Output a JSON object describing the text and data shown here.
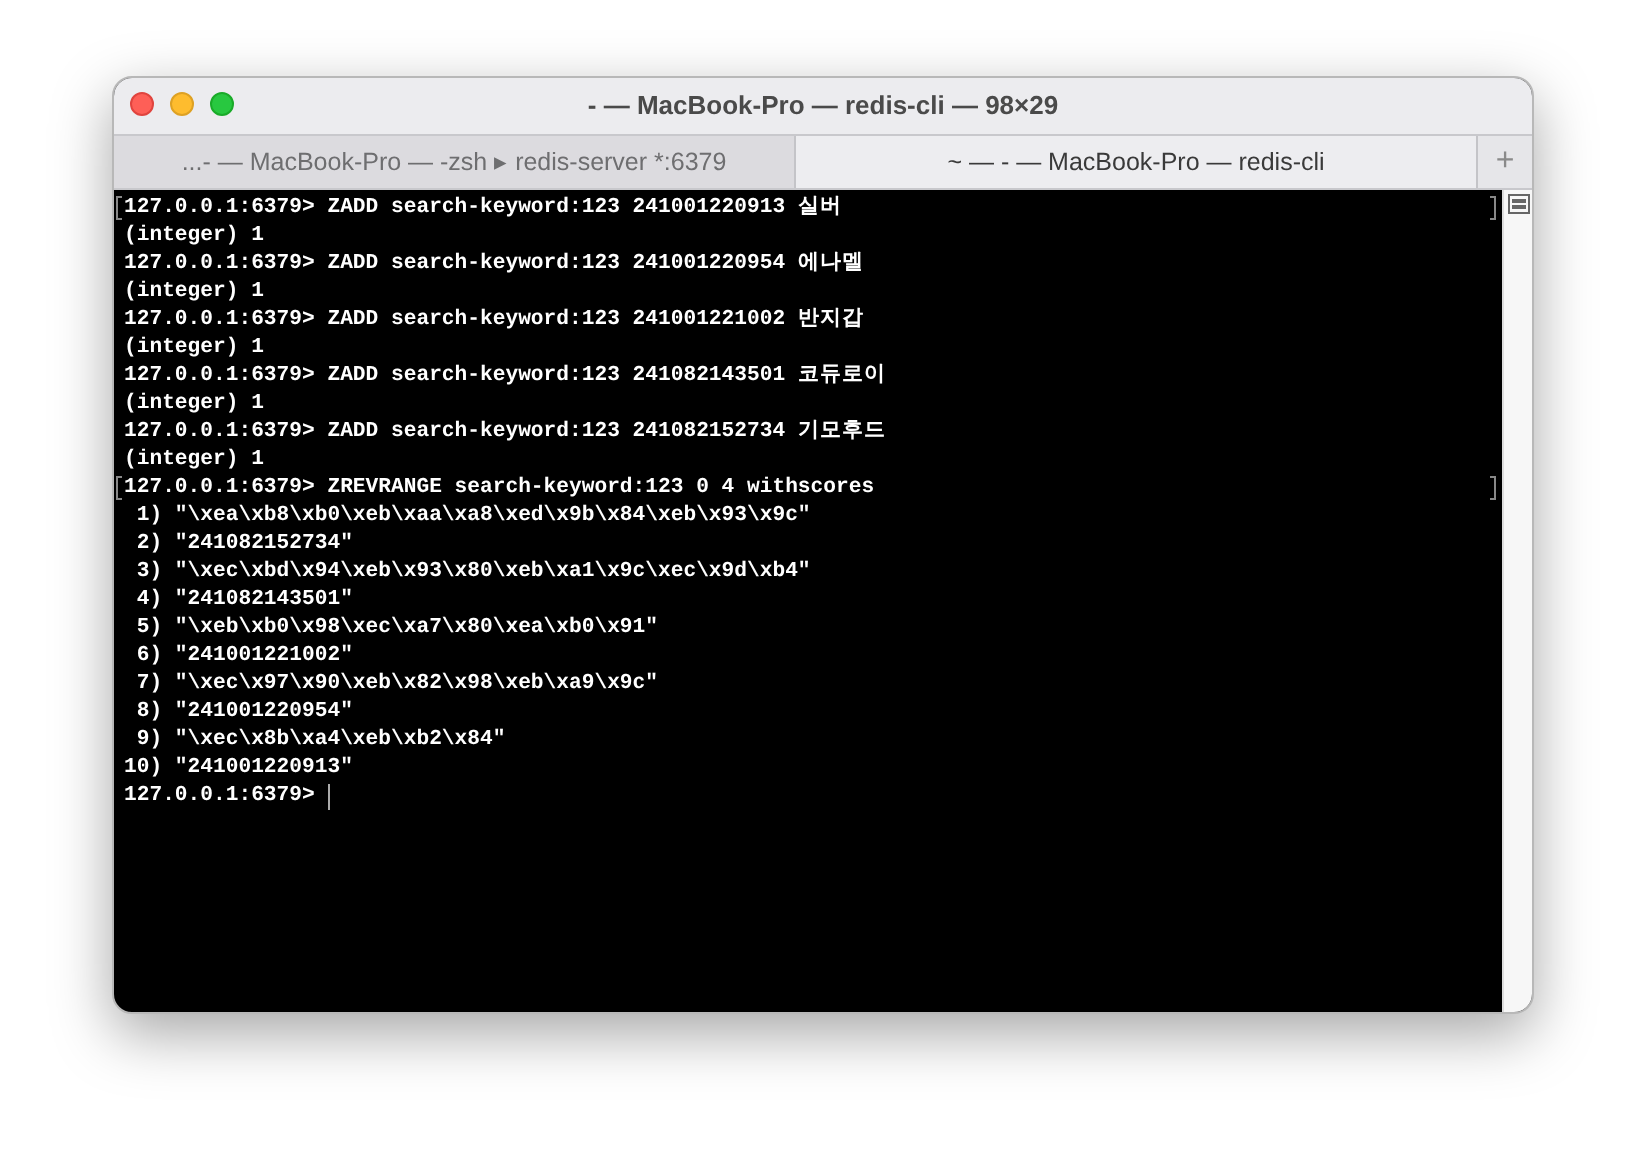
{
  "window": {
    "title": "- —  MacBook-Pro — redis-cli — 98×29"
  },
  "tabs": [
    {
      "label": "...- —  MacBook-Pro — -zsh ▸ redis-server *:6379",
      "selected": false
    },
    {
      "label": "~ — - —  MacBook-Pro — redis-cli",
      "selected": true
    }
  ],
  "new_tab": "+",
  "terminal": {
    "lines": [
      {
        "text": "127.0.0.1:6379> ZADD search-keyword:123 241001220913 실버",
        "marked": true
      },
      {
        "text": "(integer) 1",
        "marked": false
      },
      {
        "text": "127.0.0.1:6379> ZADD search-keyword:123 241001220954 에나멜",
        "marked": false
      },
      {
        "text": "(integer) 1",
        "marked": false
      },
      {
        "text": "127.0.0.1:6379> ZADD search-keyword:123 241001221002 반지갑",
        "marked": false
      },
      {
        "text": "(integer) 1",
        "marked": false
      },
      {
        "text": "127.0.0.1:6379> ZADD search-keyword:123 241082143501 코듀로이",
        "marked": false
      },
      {
        "text": "(integer) 1",
        "marked": false
      },
      {
        "text": "127.0.0.1:6379> ZADD search-keyword:123 241082152734 기모후드",
        "marked": false
      },
      {
        "text": "(integer) 1",
        "marked": false
      },
      {
        "text": "127.0.0.1:6379> ZREVRANGE search-keyword:123 0 4 withscores",
        "marked": true
      },
      {
        "text": " 1) \"\\xea\\xb8\\xb0\\xeb\\xaa\\xa8\\xed\\x9b\\x84\\xeb\\x93\\x9c\"",
        "marked": false
      },
      {
        "text": " 2) \"241082152734\"",
        "marked": false
      },
      {
        "text": " 3) \"\\xec\\xbd\\x94\\xeb\\x93\\x80\\xeb\\xa1\\x9c\\xec\\x9d\\xb4\"",
        "marked": false
      },
      {
        "text": " 4) \"241082143501\"",
        "marked": false
      },
      {
        "text": " 5) \"\\xeb\\xb0\\x98\\xec\\xa7\\x80\\xea\\xb0\\x91\"",
        "marked": false
      },
      {
        "text": " 6) \"241001221002\"",
        "marked": false
      },
      {
        "text": " 7) \"\\xec\\x97\\x90\\xeb\\x82\\x98\\xeb\\xa9\\x9c\"",
        "marked": false
      },
      {
        "text": " 8) \"241001220954\"",
        "marked": false
      },
      {
        "text": " 9) \"\\xec\\x8b\\xa4\\xeb\\xb2\\x84\"",
        "marked": false
      },
      {
        "text": "10) \"241001220913\"",
        "marked": false
      }
    ],
    "prompt": "127.0.0.1:6379>"
  }
}
